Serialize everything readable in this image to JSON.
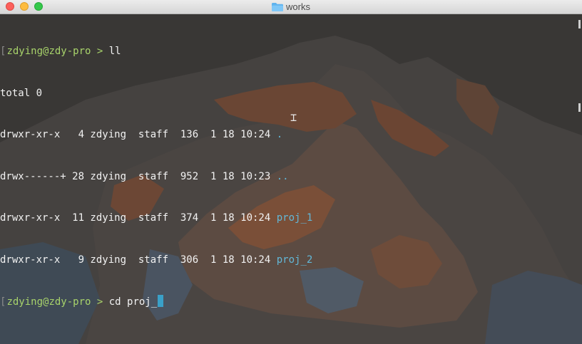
{
  "window": {
    "title": "works"
  },
  "terminal": {
    "lines": [
      {
        "prompt": "zdying@zdy-pro > ",
        "command": "ll"
      },
      {
        "text": "total 0"
      },
      {
        "meta": "drwxr-xr-x   4 zdying  staff  136  1 18 10:24 ",
        "name": "."
      },
      {
        "meta": "drwx------+ 28 zdying  staff  952  1 18 10:23 ",
        "name": ".."
      },
      {
        "meta": "drwxr-xr-x  11 zdying  staff  374  1 18 10:24 ",
        "name": "proj_1"
      },
      {
        "meta": "drwxr-xr-x   9 zdying  staff  306  1 18 10:24 ",
        "name": "proj_2"
      },
      {
        "prompt": "zdying@zdy-pro > ",
        "command": "cd proj_"
      }
    ]
  },
  "colors": {
    "prompt": "#a8d36b",
    "directory": "#62b8d8",
    "cursor": "#3aa0c8",
    "background": "#3a3837"
  },
  "icons": {
    "folder": "folder-icon",
    "cursor": "text-ibeam-icon"
  }
}
